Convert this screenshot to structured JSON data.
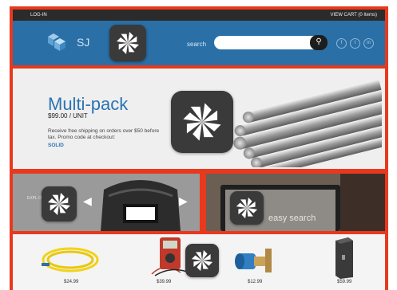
{
  "topbar": {
    "login": "LOG-IN",
    "cart": "VIEW CART (0 Items)"
  },
  "header": {
    "logo_text": "SJ",
    "search_label": "search",
    "search_value": "",
    "social": [
      "f",
      "t",
      "in"
    ]
  },
  "hero": {
    "title": "Multi-pack",
    "price": "$99.00 / UNIT",
    "desc": "Receive free shipping on orders over $50 before tax. Promo code at checkout:",
    "code": "SOLID"
  },
  "promo_left": {
    "text": "EXPL OUR LINE"
  },
  "promo_right": {
    "text": "easy search"
  },
  "products": [
    {
      "name": "fiber-optic-cable",
      "price": "$24.99"
    },
    {
      "name": "multimeter",
      "price": "$39.99"
    },
    {
      "name": "coupling-connector",
      "price": "$12.99"
    },
    {
      "name": "external-hard-drive",
      "price": "$59.99"
    }
  ],
  "colors": {
    "accent": "#e8391e",
    "header": "#2a6fa6",
    "brand_text": "#2a73b4"
  }
}
